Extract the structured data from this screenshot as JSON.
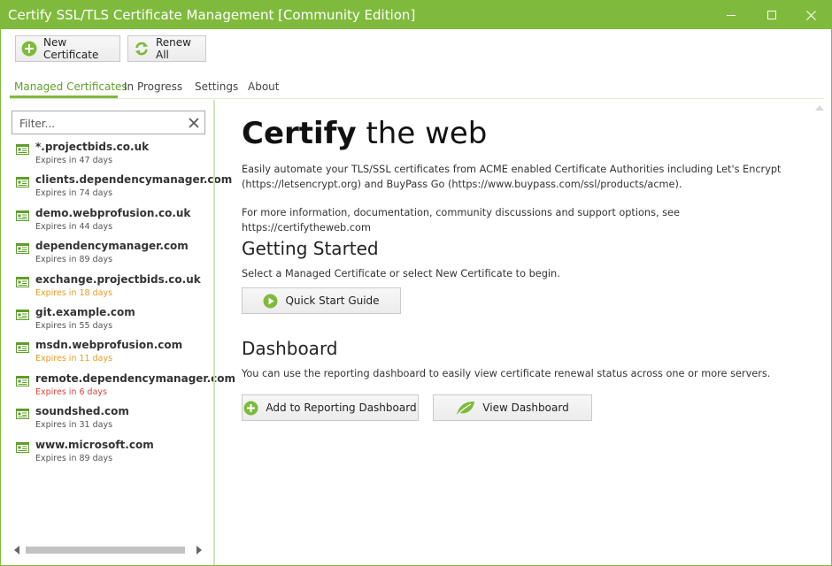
{
  "window": {
    "title": "Certify SSL/TLS Certificate Management [Community Edition]",
    "accent_color": "#7fba3c",
    "controls": [
      "minimize-icon",
      "maximize-icon",
      "close-icon"
    ]
  },
  "toolbar": {
    "new_certificate": "New Certificate",
    "renew_all": "Renew All"
  },
  "tabs": [
    {
      "label": "Managed Certificates",
      "active": true
    },
    {
      "label": "In Progress",
      "active": false
    },
    {
      "label": "Settings",
      "active": false
    },
    {
      "label": "About",
      "active": false
    }
  ],
  "sidebar": {
    "filter_placeholder": "Filter...",
    "filter_value": "",
    "certificates": [
      {
        "name": "*.projectbids.co.uk",
        "expires": "Expires in 47 days",
        "status_color": "#555555"
      },
      {
        "name": "clients.dependencymanager.com",
        "expires": "Expires in 74 days",
        "status_color": "#555555"
      },
      {
        "name": "demo.webprofusion.co.uk",
        "expires": "Expires in 44 days",
        "status_color": "#555555"
      },
      {
        "name": "dependencymanager.com",
        "expires": "Expires in 89 days",
        "status_color": "#555555"
      },
      {
        "name": "exchange.projectbids.co.uk",
        "expires": "Expires in 18 days",
        "status_color": "#e89a1e"
      },
      {
        "name": "git.example.com",
        "expires": "Expires in 55 days",
        "status_color": "#555555"
      },
      {
        "name": "msdn.webprofusion.com",
        "expires": "Expires in 11 days",
        "status_color": "#e89a1e"
      },
      {
        "name": "remote.dependencymanager.com",
        "expires": "Expires in 6 days",
        "status_color": "#d9443a"
      },
      {
        "name": "soundshed.com",
        "expires": "Expires in 31 days",
        "status_color": "#555555"
      },
      {
        "name": "www.microsoft.com",
        "expires": "Expires in 89 days",
        "status_color": "#555555"
      }
    ]
  },
  "main": {
    "hero_bold": "Certify",
    "hero_light": " the web",
    "intro": "Easily automate your TLS/SSL certificates from ACME enabled Certificate Authorities including Let's Encrypt (https://letsencrypt.org) and BuyPass Go (https://www.buypass.com/ssl/products/acme).",
    "more_info": "For more information, documentation, community discussions and support options, see https://certifytheweb.com",
    "getting_started": {
      "heading": "Getting Started",
      "text": "Select a Managed Certificate or select New Certificate to begin.",
      "button": "Quick Start Guide"
    },
    "dashboard": {
      "heading": "Dashboard",
      "text": "You can use the reporting dashboard to easily view certificate renewal status across one or more servers.",
      "add_button": "Add to Reporting Dashboard",
      "view_button": "View Dashboard"
    }
  }
}
